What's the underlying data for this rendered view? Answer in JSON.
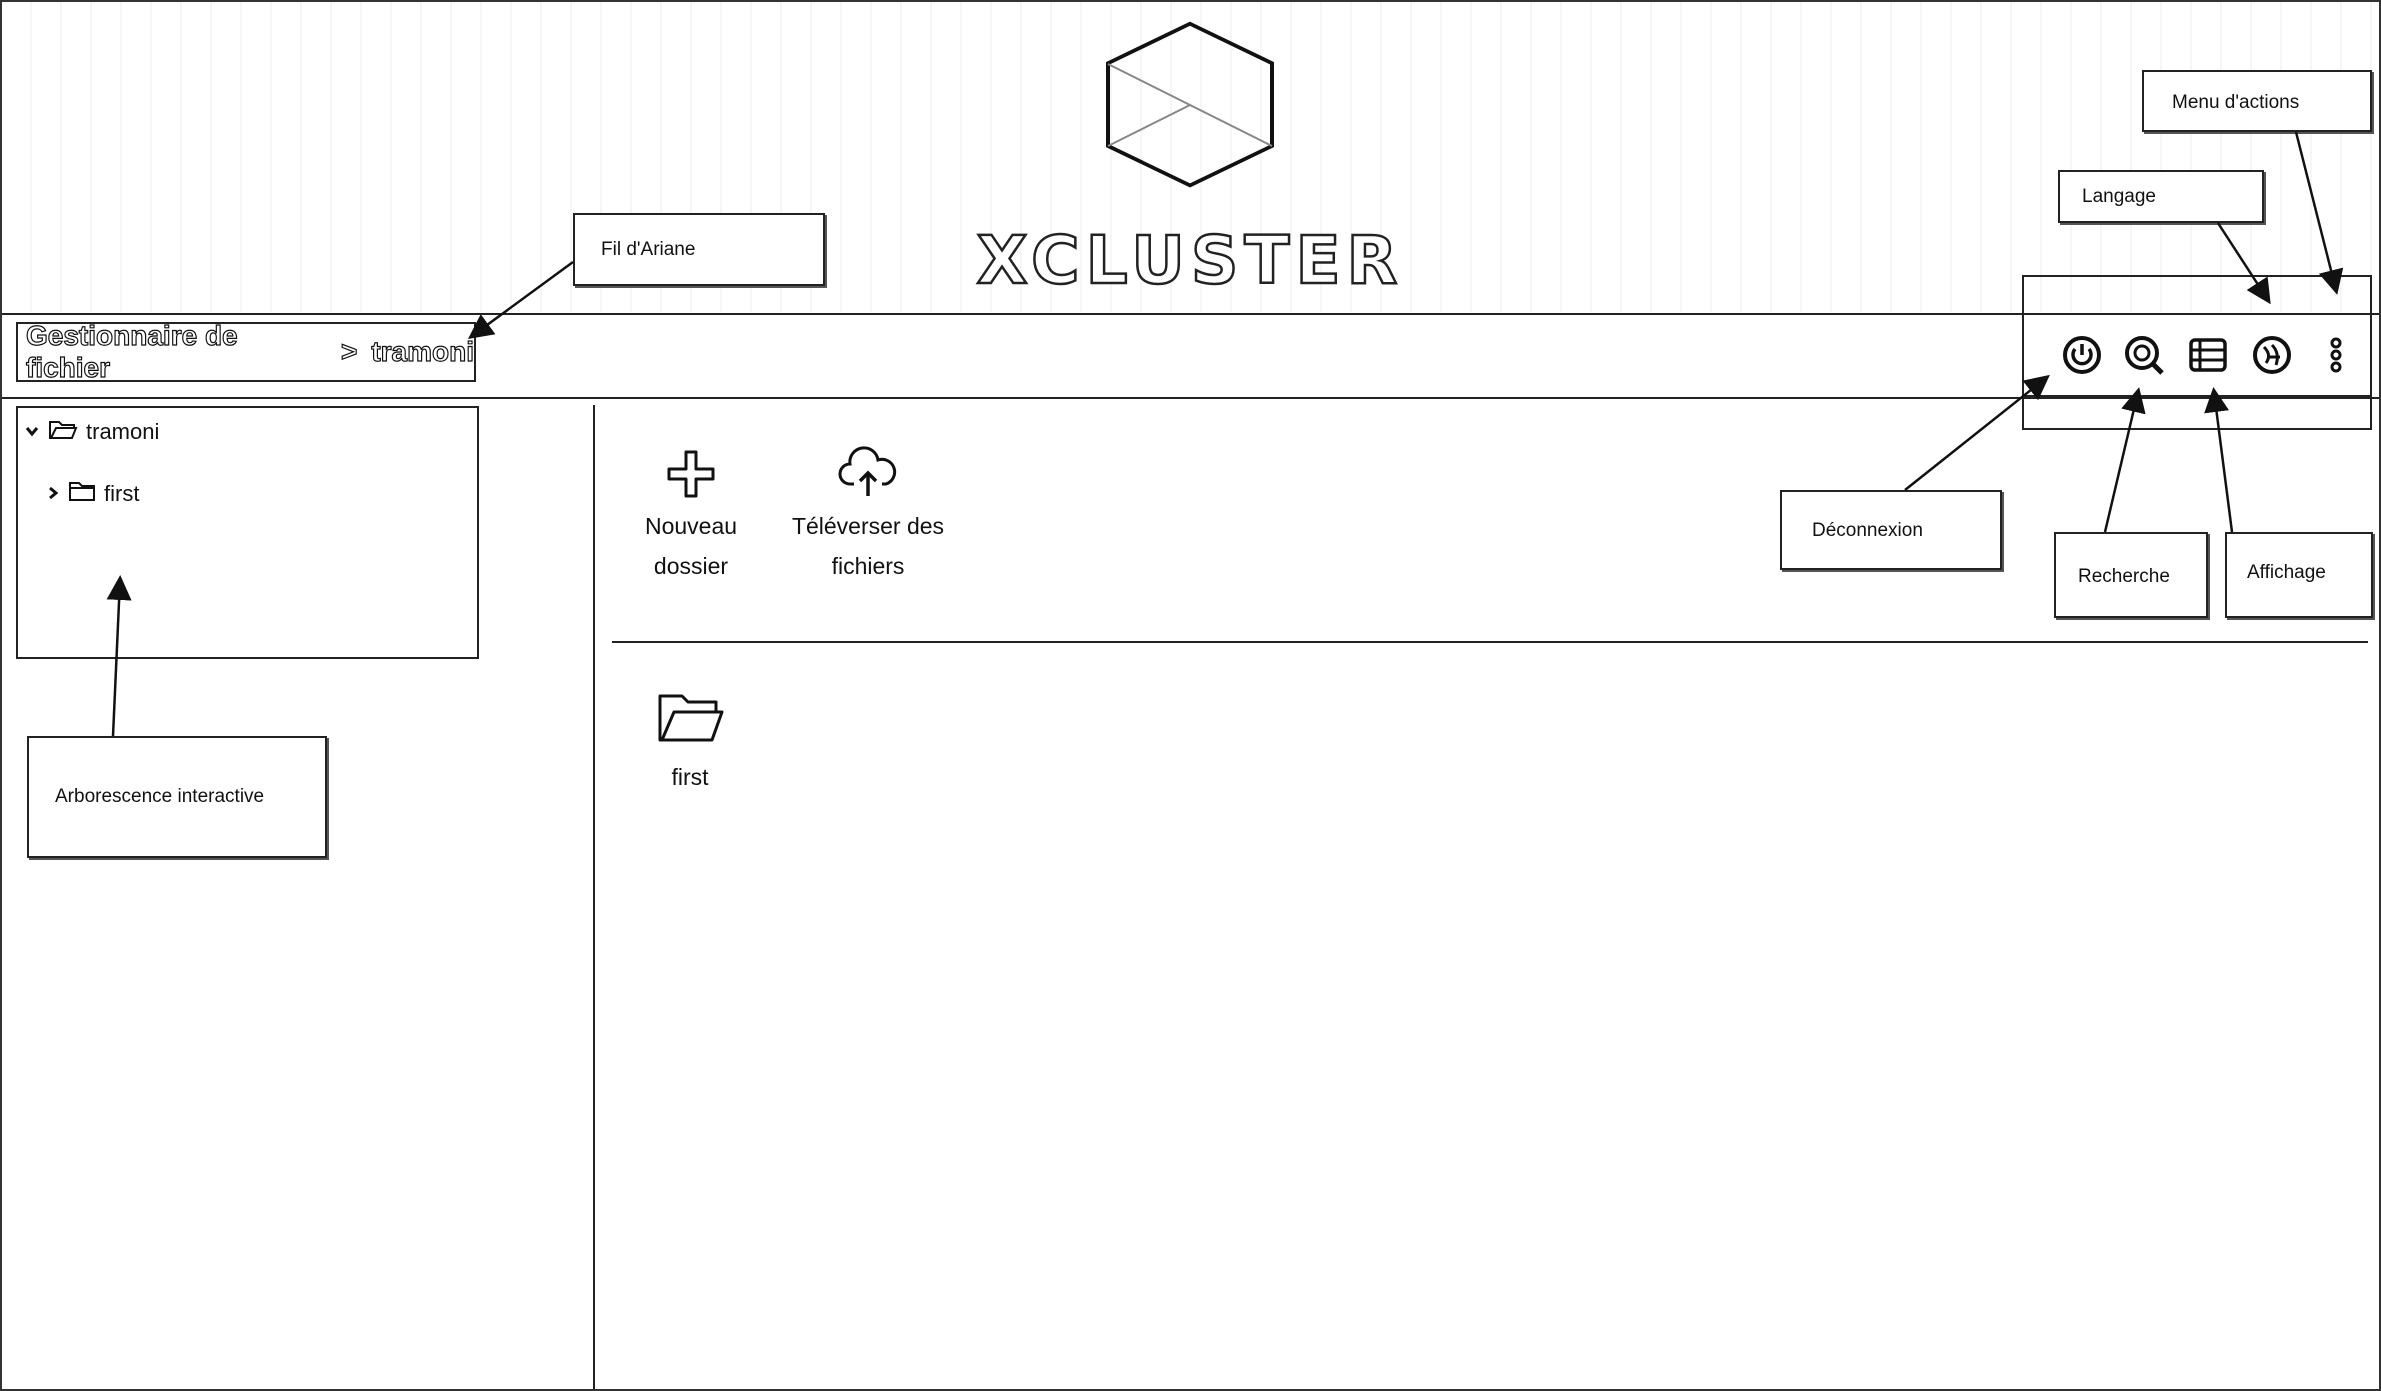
{
  "brand": {
    "name": "XCLUSTER"
  },
  "breadcrumb": {
    "root": "Gestionnaire de fichier",
    "separator": ">",
    "current": "tramoni"
  },
  "toolbar": {
    "icons": [
      "power-icon",
      "search-icon",
      "list-view-icon",
      "language-icon",
      "more-vert-icon"
    ]
  },
  "tree": {
    "root": {
      "label": "tramoni",
      "icon": "folder-open-icon",
      "expanded": true
    },
    "children": [
      {
        "label": "first",
        "icon": "folder-icon",
        "expanded": false
      }
    ]
  },
  "actions": {
    "new_folder": {
      "line1": "Nouveau",
      "line2": "dossier"
    },
    "upload": {
      "line1": "Téléverser des",
      "line2": "fichiers"
    }
  },
  "files": [
    {
      "name": "first",
      "icon": "folder-open-icon"
    }
  ],
  "annotations": {
    "breadcrumb": "Fil d'Ariane",
    "action_menu": "Menu d'actions",
    "language": "Langage",
    "logout": "Déconnexion",
    "search": "Recherche",
    "display": "Affichage",
    "tree": "Arborescence interactive"
  }
}
